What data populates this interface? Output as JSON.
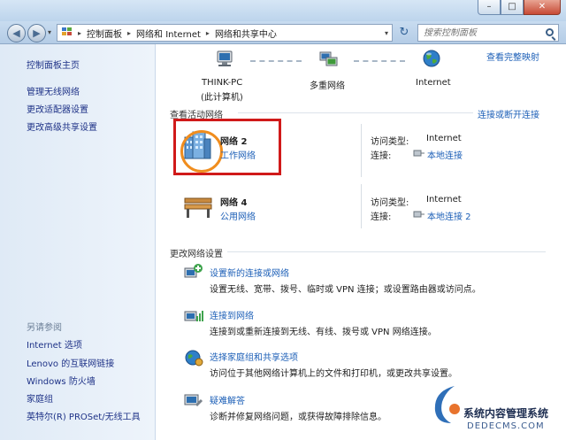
{
  "titlebar": {
    "buttons": {
      "minimize": "–",
      "maximize": "□",
      "close": "✕"
    }
  },
  "navbar": {
    "back": "◀",
    "forward": "▶",
    "breadcrumbs": [
      "控制面板",
      "网络和 Internet",
      "网络和共享中心"
    ],
    "refresh": "↻",
    "search_placeholder": "搜索控制面板"
  },
  "sidebar": {
    "home": "控制面板主页",
    "items": [
      "管理无线网络",
      "更改适配器设置",
      "更改高级共享设置"
    ],
    "see_also_title": "另请参阅",
    "see_also": [
      "Internet 选项",
      "Lenovo 的互联网链接",
      "Windows 防火墙",
      "家庭组",
      "英特尔(R) PROSet/无线工具"
    ]
  },
  "network_map": {
    "view_full_map": "查看完整映射",
    "nodes": [
      {
        "name": "THINK-PC",
        "sub": "(此计算机)"
      },
      {
        "name": "多重网络",
        "sub": ""
      },
      {
        "name": "Internet",
        "sub": ""
      }
    ]
  },
  "active_networks": {
    "title": "查看活动网络",
    "connect_link": "连接或断开连接",
    "access_type_label": "访问类型:",
    "connection_label": "连接:",
    "networks": [
      {
        "name": "网络  2",
        "category": "工作网络",
        "access_type": "Internet",
        "connection": "本地连接"
      },
      {
        "name": "网络  4",
        "category": "公用网络",
        "access_type": "Internet",
        "connection": "本地连接 2"
      }
    ]
  },
  "change_settings": {
    "title": "更改网络设置",
    "tasks": [
      {
        "title": "设置新的连接或网络",
        "desc": "设置无线、宽带、拨号、临时或 VPN 连接；或设置路由器或访问点。"
      },
      {
        "title": "连接到网络",
        "desc": "连接到或重新连接到无线、有线、拨号或 VPN 网络连接。"
      },
      {
        "title": "选择家庭组和共享选项",
        "desc": "访问位于其他网络计算机上的文件和打印机，或更改共享设置。"
      },
      {
        "title": "疑难解答",
        "desc": "诊断并修复网络问题，或获得故障排除信息。"
      }
    ]
  },
  "watermark": {
    "line1": "系统内容管理系统",
    "line2": "DEDECMS.COM"
  },
  "colors": {
    "link": "#1c5fb7",
    "highlight_box": "#d01a1a",
    "orange_ring": "#f08d1e"
  }
}
